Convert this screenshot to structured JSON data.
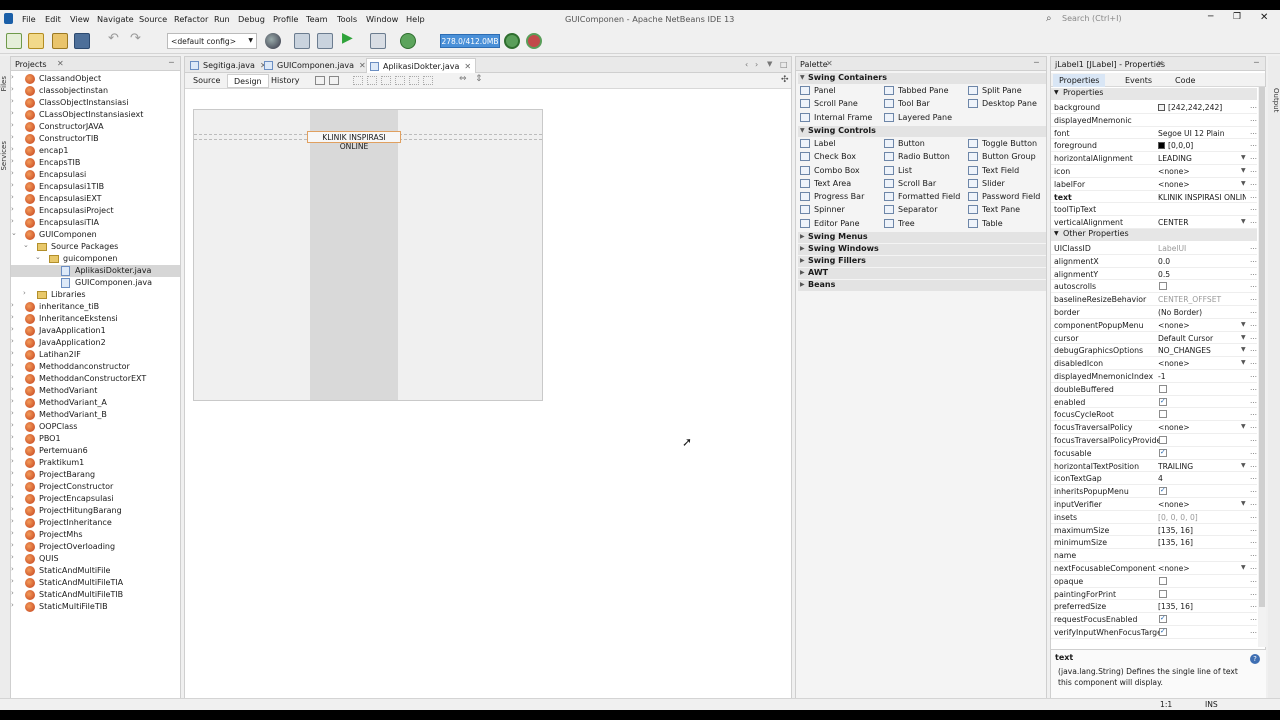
{
  "window_title": "GUIComponen - Apache NetBeans IDE 13",
  "menu": [
    "File",
    "Edit",
    "View",
    "Navigate",
    "Source",
    "Refactor",
    "Run",
    "Debug",
    "Profile",
    "Team",
    "Tools",
    "Window",
    "Help"
  ],
  "search_placeholder": "Search (Ctrl+I)",
  "toolbar": {
    "config": "<default config>",
    "memory": "278.0/412.0MB"
  },
  "left_tabs": [
    "Files",
    "Services"
  ],
  "projects": {
    "title": "Projects",
    "items": [
      {
        "label": "ClassandObject",
        "type": "project",
        "level": 0,
        "expanded": false
      },
      {
        "label": "classobjectinstan",
        "type": "project",
        "level": 0,
        "expanded": false
      },
      {
        "label": "ClassObjectInstansiasi",
        "type": "project",
        "level": 0,
        "expanded": false
      },
      {
        "label": "CLassObjectInstansiasiext",
        "type": "project",
        "level": 0,
        "expanded": false
      },
      {
        "label": "ConstructorJAVA",
        "type": "project",
        "level": 0,
        "expanded": false
      },
      {
        "label": "ConstructorTIB",
        "type": "project",
        "level": 0,
        "expanded": false
      },
      {
        "label": "encap1",
        "type": "project",
        "level": 0,
        "expanded": false
      },
      {
        "label": "EncapsTIB",
        "type": "project",
        "level": 0,
        "expanded": false
      },
      {
        "label": "Encapsulasi",
        "type": "project",
        "level": 0,
        "expanded": false
      },
      {
        "label": "Encapsulasi1TIB",
        "type": "project",
        "level": 0,
        "expanded": false
      },
      {
        "label": "EncapsulasiEXT",
        "type": "project",
        "level": 0,
        "expanded": false
      },
      {
        "label": "EncapsulasiProject",
        "type": "project",
        "level": 0,
        "expanded": false
      },
      {
        "label": "EncapsulasiTIA",
        "type": "project",
        "level": 0,
        "expanded": false
      },
      {
        "label": "GUIComponen",
        "type": "project",
        "level": 0,
        "expanded": true
      },
      {
        "label": "Source Packages",
        "type": "folder",
        "level": 1,
        "expanded": true
      },
      {
        "label": "guicomponen",
        "type": "folder",
        "level": 2,
        "expanded": true
      },
      {
        "label": "AplikasiDokter.java",
        "type": "file",
        "level": 3,
        "selected": true
      },
      {
        "label": "GUIComponen.java",
        "type": "file",
        "level": 3
      },
      {
        "label": "Libraries",
        "type": "folder",
        "level": 1,
        "expanded": false
      },
      {
        "label": "inheritance_tiB",
        "type": "project",
        "level": 0,
        "expanded": false
      },
      {
        "label": "InheritanceEkstensi",
        "type": "project",
        "level": 0,
        "expanded": false
      },
      {
        "label": "JavaApplication1",
        "type": "project",
        "level": 0,
        "expanded": false
      },
      {
        "label": "JavaApplication2",
        "type": "project",
        "level": 0,
        "expanded": false
      },
      {
        "label": "Latihan2IF",
        "type": "project",
        "level": 0,
        "expanded": false
      },
      {
        "label": "Methoddanconstructor",
        "type": "project",
        "level": 0,
        "expanded": false
      },
      {
        "label": "MethoddanConstructorEXT",
        "type": "project",
        "level": 0,
        "expanded": false
      },
      {
        "label": "MethodVariant",
        "type": "project",
        "level": 0,
        "expanded": false
      },
      {
        "label": "MethodVariant_A",
        "type": "project",
        "level": 0,
        "expanded": false
      },
      {
        "label": "MethodVariant_B",
        "type": "project",
        "level": 0,
        "expanded": false
      },
      {
        "label": "OOPClass",
        "type": "project",
        "level": 0,
        "expanded": false
      },
      {
        "label": "PBO1",
        "type": "project",
        "level": 0,
        "expanded": false
      },
      {
        "label": "Pertemuan6",
        "type": "project",
        "level": 0,
        "expanded": false
      },
      {
        "label": "Praktikum1",
        "type": "project",
        "level": 0,
        "expanded": false
      },
      {
        "label": "ProjectBarang",
        "type": "project",
        "level": 0,
        "expanded": false
      },
      {
        "label": "ProjectConstructor",
        "type": "project",
        "level": 0,
        "expanded": false
      },
      {
        "label": "ProjectEncapsulasi",
        "type": "project",
        "level": 0,
        "expanded": false
      },
      {
        "label": "ProjectHitungBarang",
        "type": "project",
        "level": 0,
        "expanded": false
      },
      {
        "label": "ProjectInheritance",
        "type": "project",
        "level": 0,
        "expanded": false
      },
      {
        "label": "ProjectMhs",
        "type": "project",
        "level": 0,
        "expanded": false
      },
      {
        "label": "ProjectOverloading",
        "type": "project",
        "level": 0,
        "expanded": false
      },
      {
        "label": "QUIS",
        "type": "project",
        "level": 0,
        "expanded": false
      },
      {
        "label": "StaticAndMultiFile",
        "type": "project",
        "level": 0,
        "expanded": false
      },
      {
        "label": "StaticAndMultiFileTIA",
        "type": "project",
        "level": 0,
        "expanded": false
      },
      {
        "label": "StaticAndMultiFileTIB",
        "type": "project",
        "level": 0,
        "expanded": false
      },
      {
        "label": "StaticMultiFileTIB",
        "type": "project",
        "level": 0,
        "expanded": false
      }
    ]
  },
  "editor": {
    "tabs": [
      {
        "label": "Segitiga.java",
        "active": false
      },
      {
        "label": "GUIComponen.java",
        "active": false
      },
      {
        "label": "AplikasiDokter.java",
        "active": true
      }
    ],
    "views": [
      {
        "label": "Source",
        "active": false
      },
      {
        "label": "Design",
        "active": true
      },
      {
        "label": "History",
        "active": false
      }
    ],
    "label_text": "KLINIK INSPIRASI ONLINE"
  },
  "palette": {
    "title": "Palette",
    "sections": [
      {
        "name": "Swing Containers",
        "expanded": true,
        "items": [
          "Panel",
          "Tabbed Pane",
          "Split Pane",
          "Scroll Pane",
          "Tool Bar",
          "Desktop Pane",
          "Internal Frame",
          "Layered Pane"
        ]
      },
      {
        "name": "Swing Controls",
        "expanded": true,
        "items": [
          "Label",
          "Button",
          "Toggle Button",
          "Check Box",
          "Radio Button",
          "Button Group",
          "Combo Box",
          "List",
          "Text Field",
          "Text Area",
          "Scroll Bar",
          "Slider",
          "Progress Bar",
          "Formatted Field",
          "Password Field",
          "Spinner",
          "Separator",
          "Text Pane",
          "Editor Pane",
          "Tree",
          "Table"
        ]
      },
      {
        "name": "Swing Menus",
        "expanded": false,
        "items": []
      },
      {
        "name": "Swing Windows",
        "expanded": false,
        "items": []
      },
      {
        "name": "Swing Fillers",
        "expanded": false,
        "items": []
      },
      {
        "name": "AWT",
        "expanded": false,
        "items": []
      },
      {
        "name": "Beans",
        "expanded": false,
        "items": []
      }
    ]
  },
  "properties": {
    "title": "jLabel1 [JLabel] - Properties",
    "tabs": [
      {
        "label": "Properties",
        "active": true
      },
      {
        "label": "Events",
        "active": false
      },
      {
        "label": "Code",
        "active": false
      }
    ],
    "sections": [
      {
        "name": "Properties",
        "rows": [
          {
            "name": "background",
            "value": "[242,242,242]",
            "kind": "color",
            "color": "#f2f2f2"
          },
          {
            "name": "displayedMnemonic",
            "value": ""
          },
          {
            "name": "font",
            "value": "Segoe UI 12 Plain"
          },
          {
            "name": "foreground",
            "value": "[0,0,0]",
            "kind": "color",
            "color": "#000000"
          },
          {
            "name": "horizontalAlignment",
            "value": "LEADING",
            "dropdown": true
          },
          {
            "name": "icon",
            "value": "<none>",
            "dropdown": true
          },
          {
            "name": "labelFor",
            "value": "<none>",
            "dropdown": true
          },
          {
            "name": "text",
            "value": "KLINIK INSPIRASI ONLINE",
            "bold": true
          },
          {
            "name": "toolTipText",
            "value": ""
          },
          {
            "name": "verticalAlignment",
            "value": "CENTER",
            "dropdown": true
          }
        ]
      },
      {
        "name": "Other Properties",
        "rows": [
          {
            "name": "UIClassID",
            "value": "LabelUI",
            "gray": true
          },
          {
            "name": "alignmentX",
            "value": "0.0"
          },
          {
            "name": "alignmentY",
            "value": "0.5"
          },
          {
            "name": "autoscrolls",
            "value": "",
            "kind": "check",
            "checked": false
          },
          {
            "name": "baselineResizeBehavior",
            "value": "CENTER_OFFSET",
            "gray": true
          },
          {
            "name": "border",
            "value": "(No Border)"
          },
          {
            "name": "componentPopupMenu",
            "value": "<none>",
            "dropdown": true
          },
          {
            "name": "cursor",
            "value": "Default Cursor",
            "dropdown": true
          },
          {
            "name": "debugGraphicsOptions",
            "value": "NO_CHANGES",
            "dropdown": true
          },
          {
            "name": "disabledIcon",
            "value": "<none>",
            "dropdown": true
          },
          {
            "name": "displayedMnemonicIndex",
            "value": "-1"
          },
          {
            "name": "doubleBuffered",
            "value": "",
            "kind": "check",
            "checked": false
          },
          {
            "name": "enabled",
            "value": "",
            "kind": "check",
            "checked": true
          },
          {
            "name": "focusCycleRoot",
            "value": "",
            "kind": "check",
            "checked": false
          },
          {
            "name": "focusTraversalPolicy",
            "value": "<none>",
            "dropdown": true
          },
          {
            "name": "focusTraversalPolicyProvider",
            "value": "",
            "kind": "check",
            "checked": false
          },
          {
            "name": "focusable",
            "value": "",
            "kind": "check",
            "checked": true
          },
          {
            "name": "horizontalTextPosition",
            "value": "TRAILING",
            "dropdown": true
          },
          {
            "name": "iconTextGap",
            "value": "4"
          },
          {
            "name": "inheritsPopupMenu",
            "value": "",
            "kind": "check",
            "checked": true
          },
          {
            "name": "inputVerifier",
            "value": "<none>",
            "dropdown": true
          },
          {
            "name": "insets",
            "value": "[0, 0, 0, 0]",
            "gray": true
          },
          {
            "name": "maximumSize",
            "value": "[135, 16]"
          },
          {
            "name": "minimumSize",
            "value": "[135, 16]"
          },
          {
            "name": "name",
            "value": ""
          },
          {
            "name": "nextFocusableComponent",
            "value": "<none>",
            "dropdown": true
          },
          {
            "name": "opaque",
            "value": "",
            "kind": "check",
            "checked": false
          },
          {
            "name": "paintingForPrint",
            "value": "",
            "kind": "check",
            "checked": false
          },
          {
            "name": "preferredSize",
            "value": "[135, 16]"
          },
          {
            "name": "requestFocusEnabled",
            "value": "",
            "kind": "check",
            "checked": true
          },
          {
            "name": "verifyInputWhenFocusTarget",
            "value": "",
            "kind": "check",
            "checked": true
          }
        ]
      }
    ],
    "help_title": "text",
    "help_desc": "(java.lang.String) Defines the single line of text this component will display."
  },
  "right_tabs": [
    "Output"
  ],
  "status": {
    "position": "1:1",
    "mode": "INS"
  }
}
